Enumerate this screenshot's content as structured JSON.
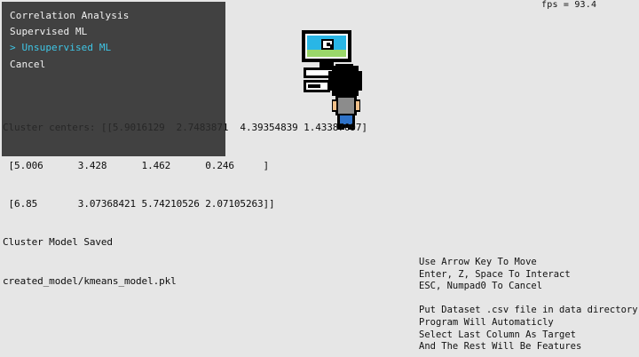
{
  "hud": {
    "fps": "fps = 93.4"
  },
  "console": {
    "lines": [
      "Cluster centers: [[5.9016129  2.7483871  4.39354839 1.43387097]",
      " [5.006      3.428      1.462      0.246     ]",
      " [6.85       3.07368421 5.74210526 2.07105263]]",
      "Cluster Model Saved",
      "created_model/kmeans_model.pkl"
    ]
  },
  "menu": {
    "items": [
      {
        "label": "Correlation Analysis",
        "selected": false
      },
      {
        "label": "Supervised ML",
        "selected": false
      },
      {
        "label": "> Unsupervised ML",
        "selected": true
      },
      {
        "label": "Cancel",
        "selected": false
      }
    ]
  },
  "help": {
    "controls": [
      "Use Arrow Key To Move",
      "Enter, Z, Space To Interact",
      "ESC, Numpad0 To Cancel"
    ],
    "notes": [
      "Put Dataset .csv file in data directory",
      "Program Will Automaticly",
      "Select Last Column As Target",
      "And The Rest Will Be Features"
    ]
  },
  "colors": {
    "background": "#e6e6e6",
    "menu_bg": "#2a2a2a",
    "menu_text": "#f2f2f2",
    "menu_selected": "#3fc6e6"
  },
  "icons": {
    "player": "player-sprite",
    "computer": "computer-icon"
  }
}
